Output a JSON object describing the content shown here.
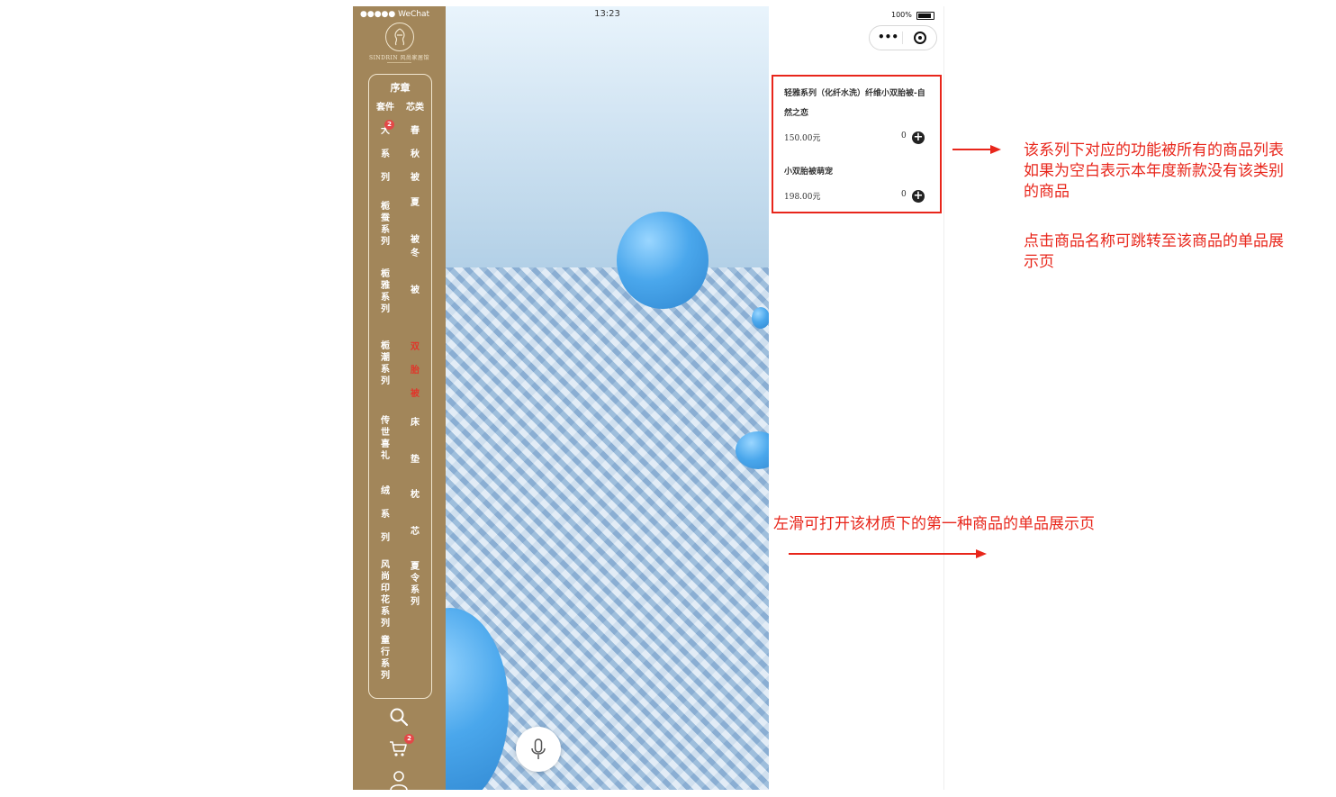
{
  "status": {
    "carrier": "●●●●● WeChat",
    "time": "13:23",
    "battery": "100%"
  },
  "brand": {
    "logo_text": "SINDRIN 风尚家居馆"
  },
  "menu": {
    "heading": "序章",
    "left_title": "套件",
    "right_title": "芯类",
    "left_items": [
      {
        "label": "大系列",
        "badge": "2"
      },
      {
        "label": "栀蚕系列"
      },
      {
        "label": "栀雅系列"
      },
      {
        "label": "栀潮系列"
      },
      {
        "label": "传世喜礼"
      },
      {
        "label": "绒系列"
      },
      {
        "label": "风尚印花系列"
      },
      {
        "label": "童行系列"
      }
    ],
    "right_items": [
      {
        "label": "春秋被"
      },
      {
        "label": "夏被"
      },
      {
        "label": "冬被"
      },
      {
        "label": "双胎被",
        "active": true
      },
      {
        "label": "床垫"
      },
      {
        "label": "枕芯"
      },
      {
        "label": "夏令系列"
      }
    ]
  },
  "sidebar_icons": {
    "search": "search-icon",
    "cart": "cart-icon",
    "cart_badge": "2",
    "user": "user-icon"
  },
  "products": [
    {
      "name": "轻雅系列（化纤水洗）纤维小双胎被-自然之恋",
      "price": "150.00元",
      "qty": "0"
    },
    {
      "name": "小双胎被萌宠",
      "price": "198.00元",
      "qty": "0"
    }
  ],
  "annotations": {
    "list_note": [
      "该系列下对应的功能被所有的商品列表",
      "如果为空白表示本年度新款没有该类别",
      "的商品"
    ],
    "jump_note": [
      "点击商品名称可跳转至该商品的单品展",
      "示页"
    ],
    "swipe_note": "左滑可打开该材质下的第一种商品的单品展示页"
  },
  "colors": {
    "sidebar": "#a2865a",
    "accent": "#e8261b",
    "active_item": "#e0362b"
  }
}
